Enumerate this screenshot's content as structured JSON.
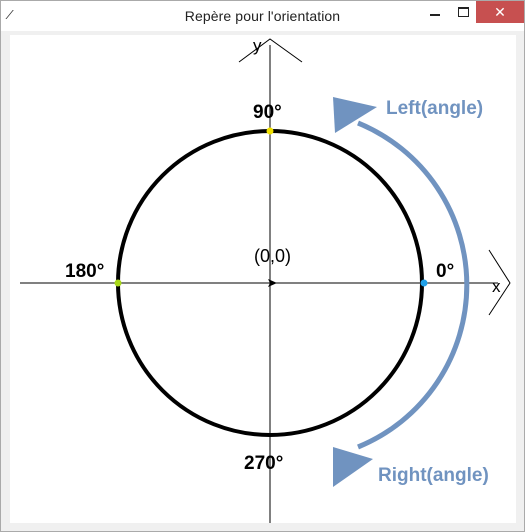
{
  "window": {
    "title": "Repère pour l'orientation",
    "close_glyph": "✕"
  },
  "canvas": {
    "labels": {
      "deg_90": "90°",
      "deg_180": "180°",
      "deg_0": "0°",
      "deg_270": "270°",
      "origin": "(0,0)",
      "x_axis": "x",
      "y_axis": "y",
      "left_rotation": "Left(angle)",
      "right_rotation": "Right(angle)"
    },
    "colors": {
      "arrow": "#7093c0",
      "marker_90": "#f0e000",
      "marker_180": "#a8d818",
      "marker_0": "#20a0e8",
      "circle": "#000000"
    }
  }
}
